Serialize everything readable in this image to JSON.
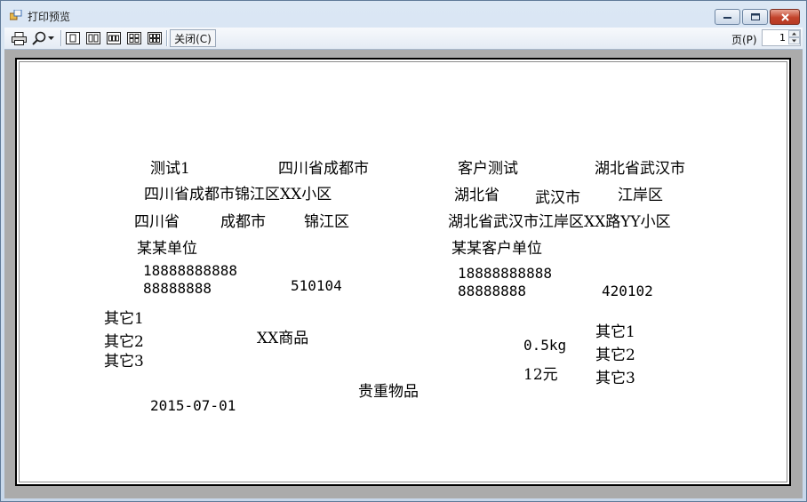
{
  "window": {
    "title": "打印预览",
    "min_icon": "minimize-icon",
    "max_icon": "maximize-icon",
    "close_icon": "close-icon"
  },
  "toolbar": {
    "close_label": "关闭(C)",
    "page_label": "页(P)",
    "page_value": "1",
    "icons": [
      "print-icon",
      "zoom-icon",
      "one-page-icon",
      "two-pages-icon",
      "three-pages-icon",
      "four-pages-icon",
      "six-pages-icon"
    ]
  },
  "preview": {
    "sender": {
      "name": "测试1",
      "city_full": "四川省成都市",
      "address": "四川省成都市锦江区XX小区",
      "province": "四川省",
      "city": "成都市",
      "district": "锦江区",
      "company": "某某单位",
      "mobile": "18888888888",
      "phone": "88888888",
      "postcode": "510104"
    },
    "receiver": {
      "name": "客户测试",
      "city_full": "湖北省武汉市",
      "province": "湖北省",
      "city": "武汉市",
      "district": "江岸区",
      "address": "湖北省武汉市江岸区XX路YY小区",
      "company": "某某客户单位",
      "mobile": "18888888888",
      "phone": "88888888",
      "postcode": "420102"
    },
    "left_others": [
      "其它1",
      "其它2",
      "其它3"
    ],
    "goods": "XX商品",
    "weight": "0.5kg",
    "price": "12元",
    "right_others": [
      "其它1",
      "其它2",
      "其它3"
    ],
    "valuables": "贵重物品",
    "date": "2015-07-01"
  }
}
